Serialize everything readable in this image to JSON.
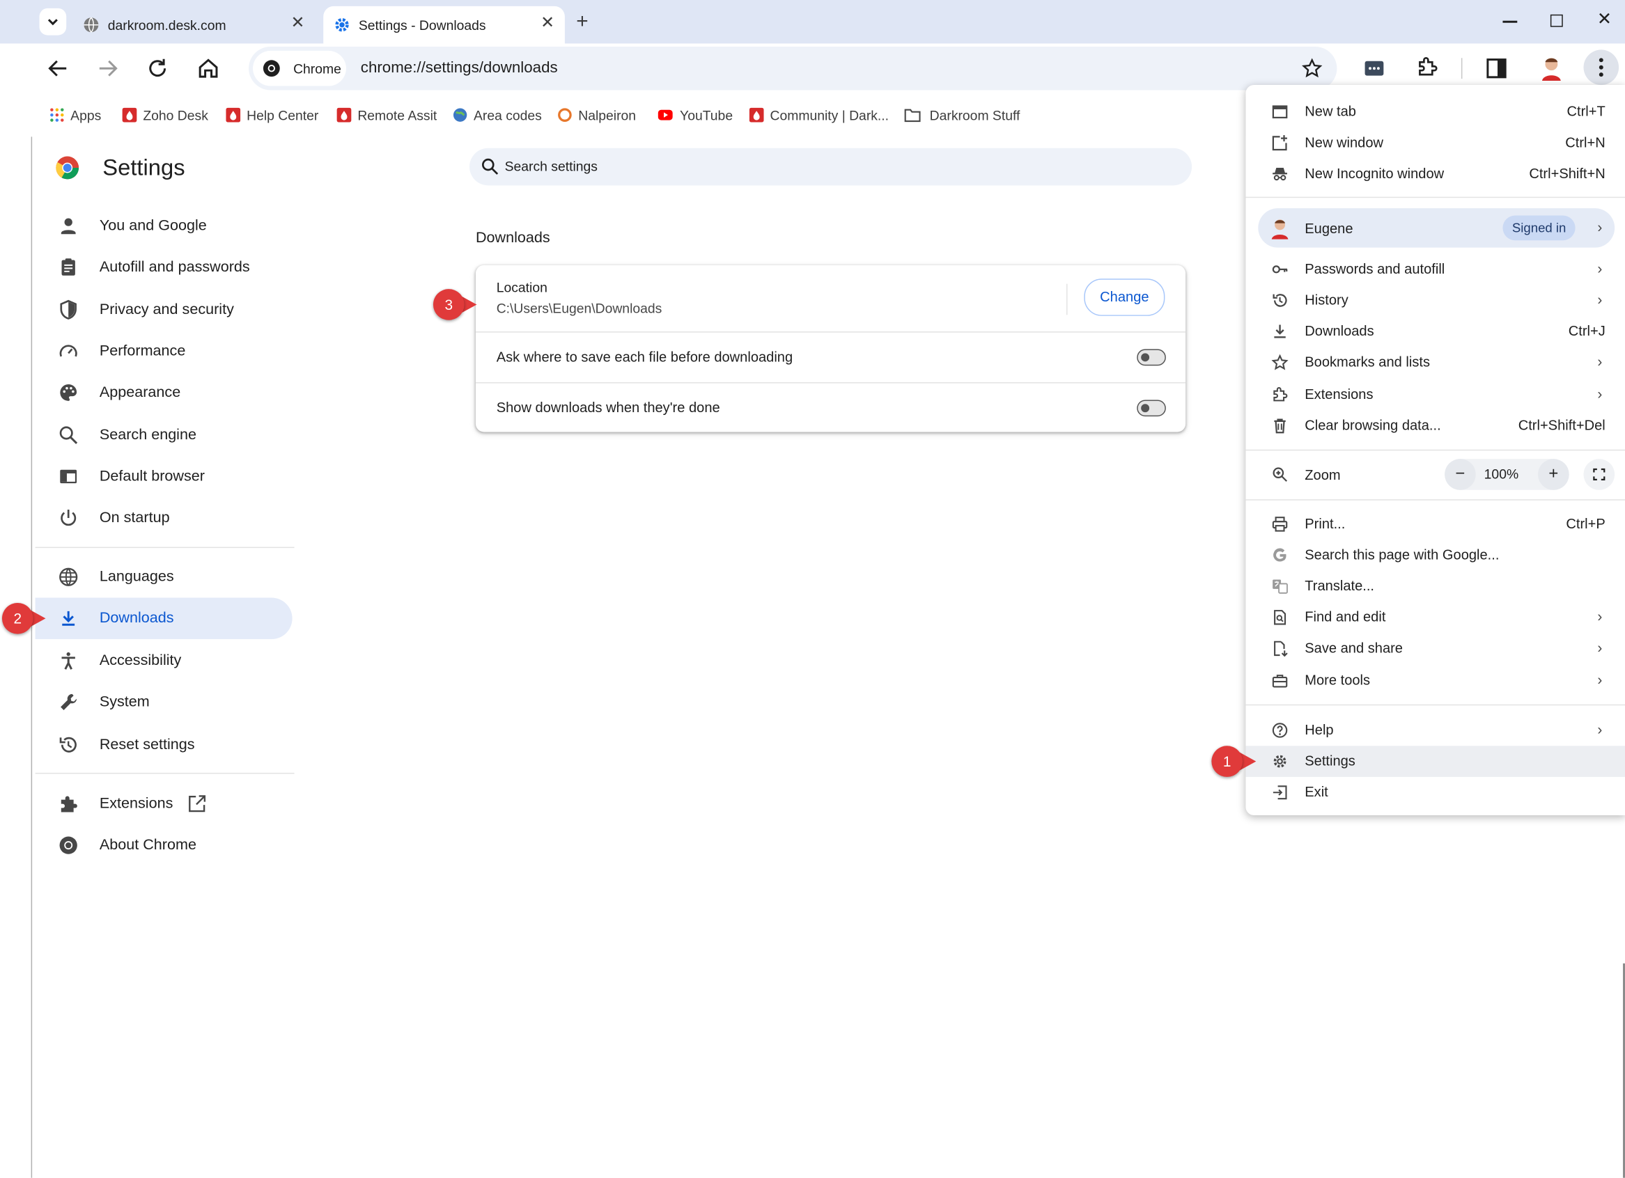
{
  "tabs": [
    {
      "title": "darkroom.desk.com"
    },
    {
      "title": "Settings - Downloads"
    }
  ],
  "toolbar": {
    "chip_label": "Chrome",
    "url": "chrome://settings/downloads"
  },
  "bookmarks": [
    "Apps",
    "Zoho Desk",
    "Help Center",
    "Remote Assit",
    "Area codes",
    "Nalpeiron",
    "YouTube",
    "Community | Dark...",
    "Darkroom Stuff"
  ],
  "settings": {
    "title": "Settings",
    "search_placeholder": "Search settings",
    "nav": [
      "You and Google",
      "Autofill and passwords",
      "Privacy and security",
      "Performance",
      "Appearance",
      "Search engine",
      "Default browser",
      "On startup",
      "Languages",
      "Downloads",
      "Accessibility",
      "System",
      "Reset settings",
      "Extensions",
      "About Chrome"
    ],
    "section_title": "Downloads",
    "location_label": "Location",
    "location_path": "C:\\Users\\Eugen\\Downloads",
    "change_button": "Change",
    "ask_where": "Ask where to save each file before downloading",
    "show_downloads": "Show downloads when they're done"
  },
  "menu": {
    "new_tab": "New tab",
    "new_tab_sc": "Ctrl+T",
    "new_window": "New window",
    "new_window_sc": "Ctrl+N",
    "incognito": "New Incognito window",
    "incognito_sc": "Ctrl+Shift+N",
    "profile_name": "Eugene",
    "signed_in": "Signed in",
    "passwords": "Passwords and autofill",
    "history": "History",
    "downloads": "Downloads",
    "downloads_sc": "Ctrl+J",
    "bookmarks": "Bookmarks and lists",
    "extensions": "Extensions",
    "clear": "Clear browsing data...",
    "clear_sc": "Ctrl+Shift+Del",
    "zoom": "Zoom",
    "zoom_minus": "−",
    "zoom_value": "100%",
    "zoom_plus": "+",
    "print": "Print...",
    "print_sc": "Ctrl+P",
    "search_google": "Search this page with Google...",
    "translate": "Translate...",
    "find_edit": "Find and edit",
    "save_share": "Save and share",
    "more_tools": "More tools",
    "help": "Help",
    "settings": "Settings",
    "exit": "Exit"
  },
  "annotations": [
    "1",
    "2",
    "3"
  ],
  "colors": {
    "accent": "#0b57d0",
    "tabstrip": "#dfe6f5",
    "badge": "#e03a3a"
  }
}
